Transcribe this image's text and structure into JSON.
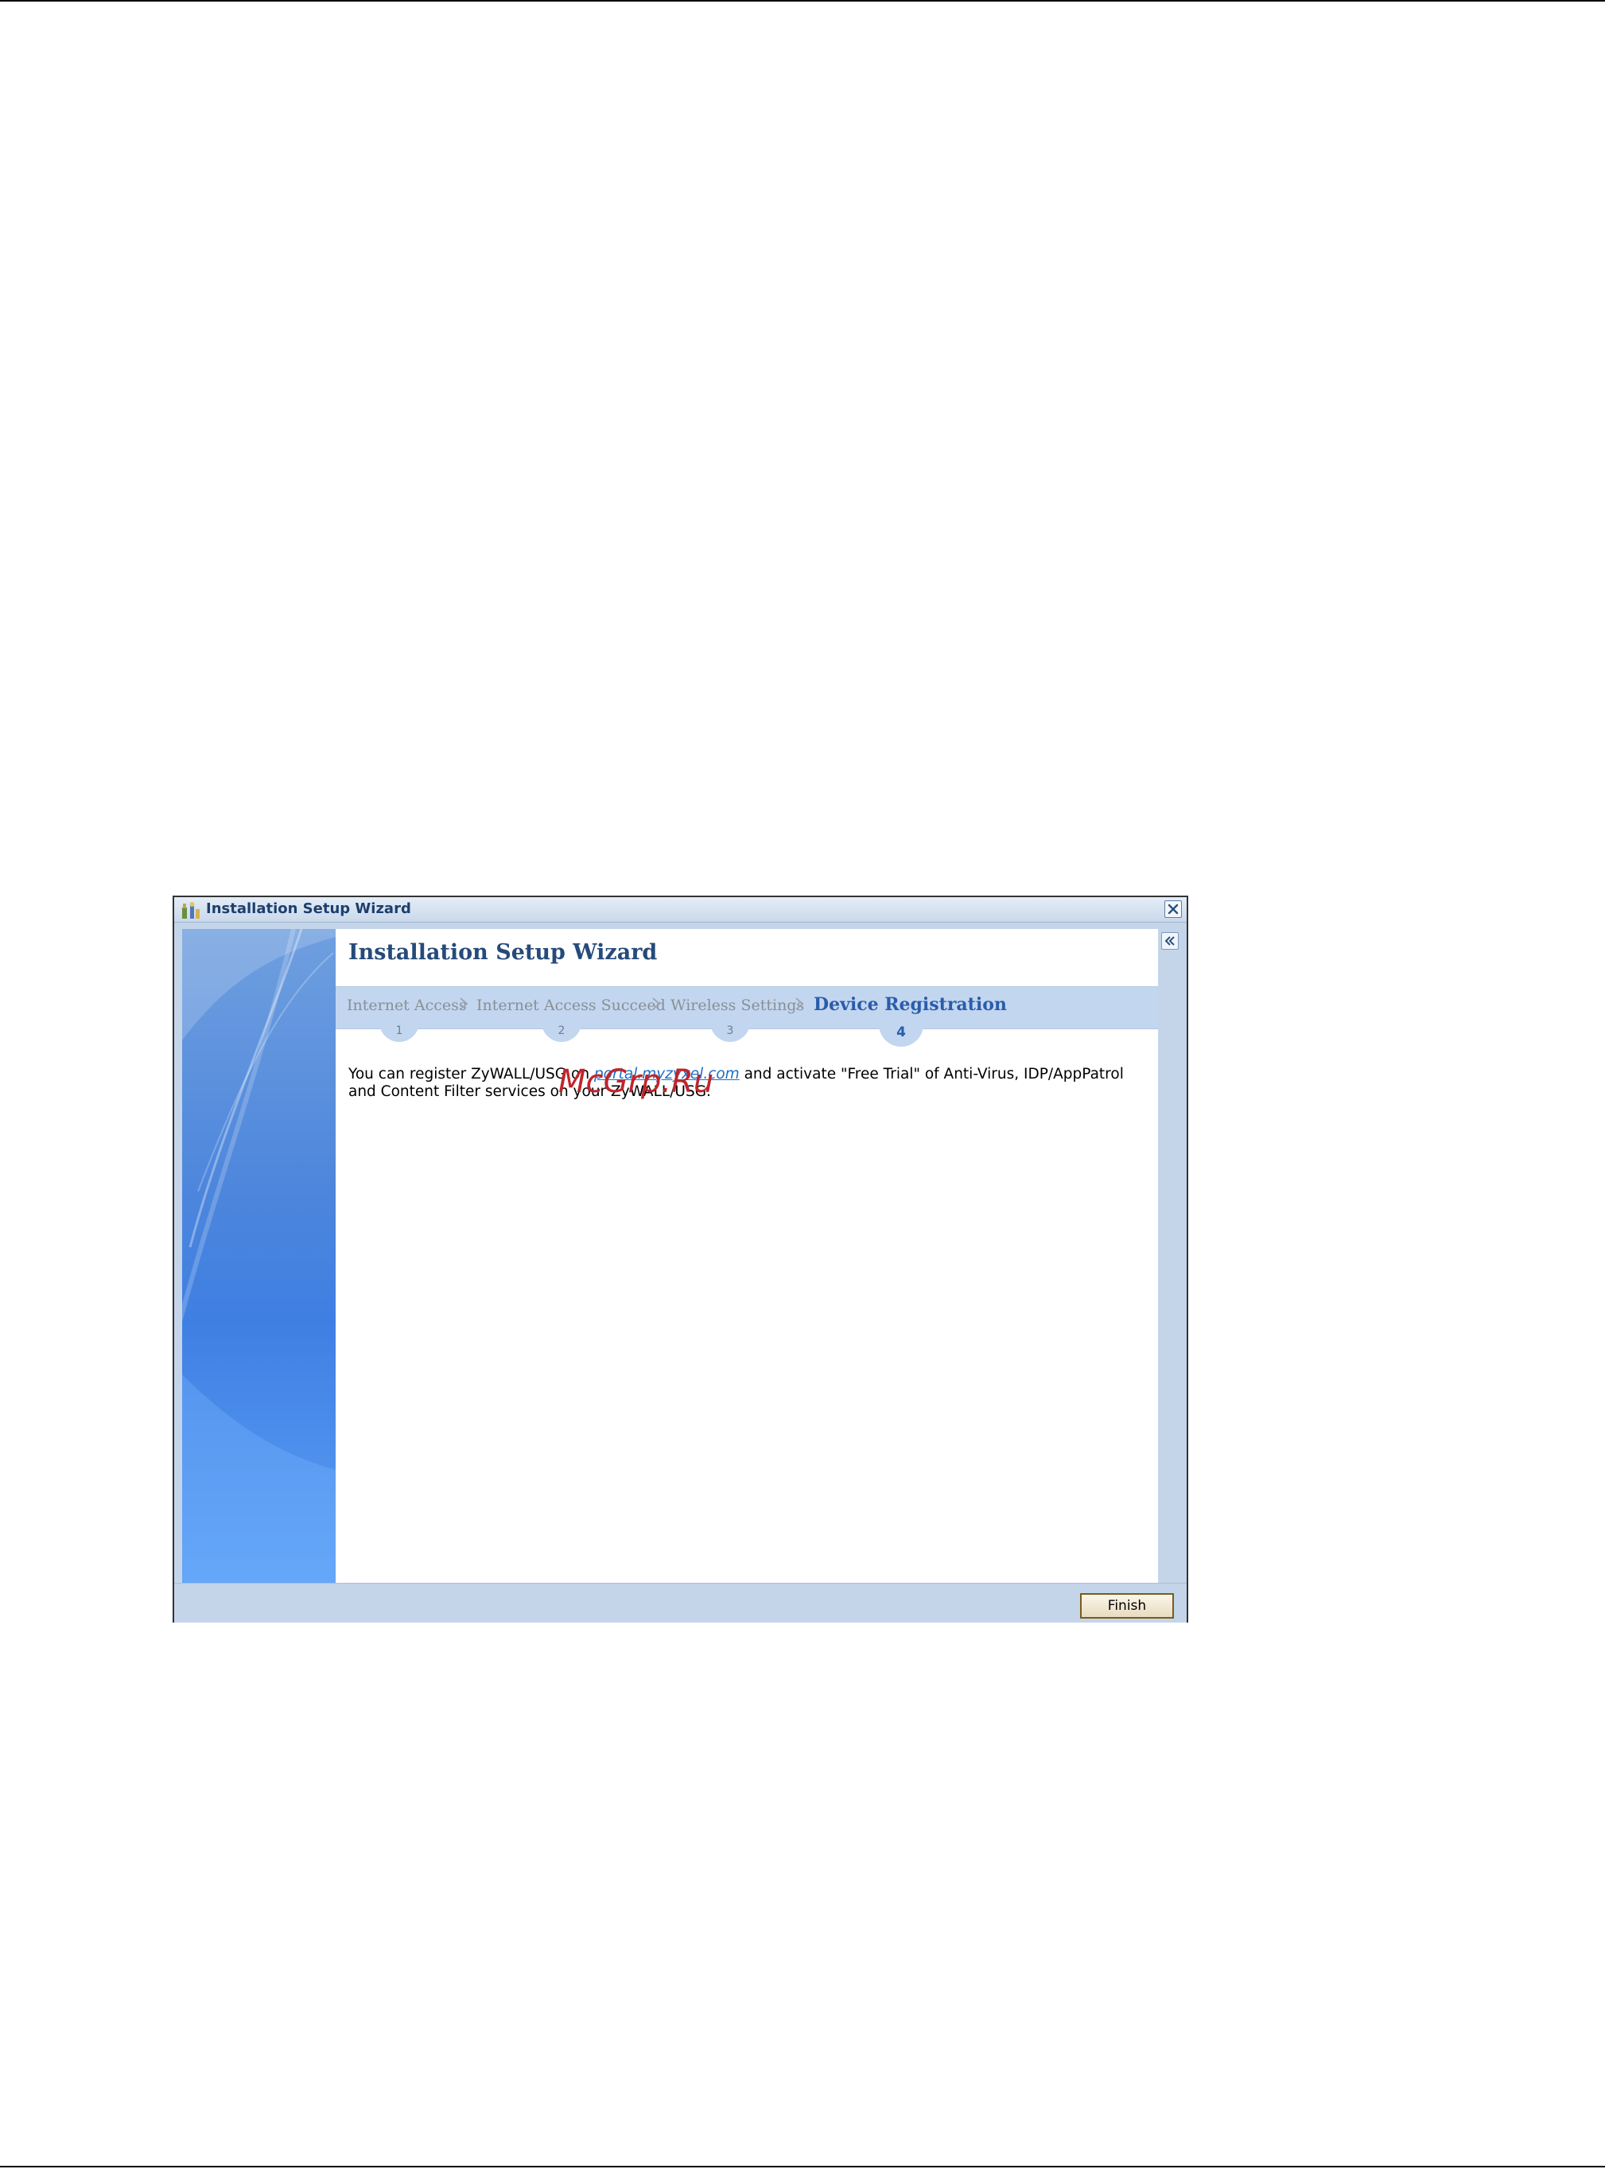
{
  "window": {
    "title": "Installation Setup Wizard",
    "close_label": "×"
  },
  "content": {
    "heading": "Installation Setup Wizard",
    "steps": [
      {
        "label": "Internet Access",
        "number": "1"
      },
      {
        "label": "Internet Access Succeed",
        "number": "2"
      },
      {
        "label": "Wireless Settings",
        "number": "3"
      },
      {
        "label": "Device Registration",
        "number": "4",
        "active": true
      }
    ],
    "body": {
      "before_link": "You can register ZyWALL/USG on ",
      "link_text": "portal.myzyxel.com",
      "after_link": " and activate \"Free Trial\" of Anti-Virus, IDP/AppPatrol and Content Filter services on your ZyWALL/USG."
    }
  },
  "footer": {
    "finish_label": "Finish"
  },
  "watermark": "McGrp.Ru",
  "colors": {
    "accent": "#2b5cab",
    "step_bar": "#c2d6ef",
    "side_panel": "#4d86dc",
    "watermark": "#c0242a"
  },
  "icons": [
    "wizard-icon",
    "close-icon",
    "collapse-icon",
    "chevron-right-icon"
  ]
}
